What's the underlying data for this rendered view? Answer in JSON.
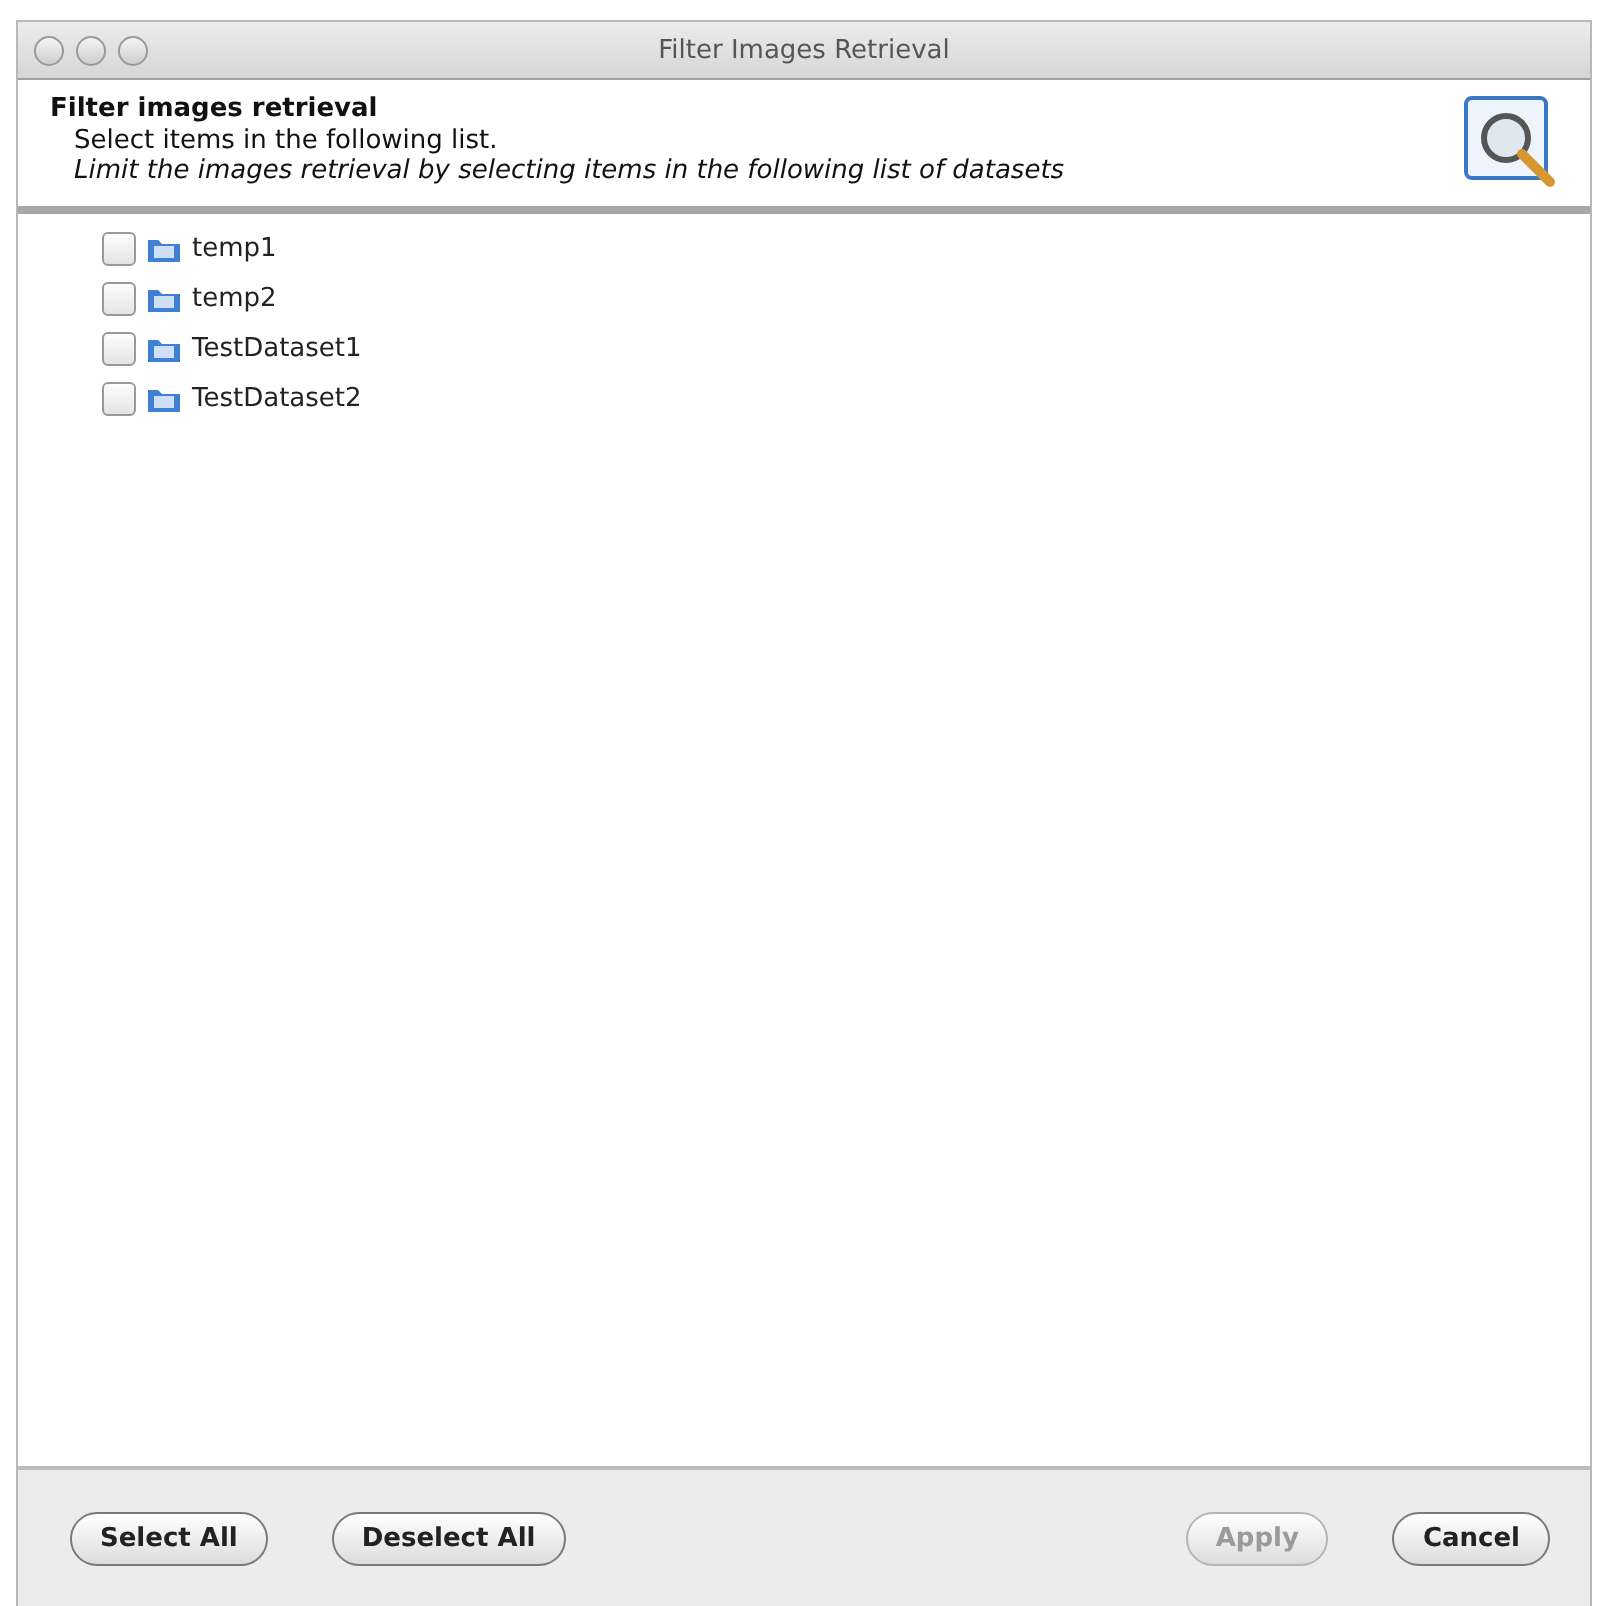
{
  "window": {
    "title": "Filter Images Retrieval"
  },
  "header": {
    "title": "Filter images retrieval",
    "subtitle": "Select items in the following list.",
    "description": "Limit the images retrieval by selecting items in the following list of datasets"
  },
  "tree": {
    "items": [
      {
        "label": "temp1",
        "checked": false
      },
      {
        "label": "temp2",
        "checked": false
      },
      {
        "label": "TestDataset1",
        "checked": false
      },
      {
        "label": "TestDataset2",
        "checked": false
      }
    ]
  },
  "buttons": [
    {
      "label": "Select All",
      "disabled": false
    },
    {
      "label": "Deselect All",
      "disabled": false
    },
    {
      "label": "Apply",
      "disabled": true
    },
    {
      "label": "Cancel",
      "disabled": false
    }
  ]
}
